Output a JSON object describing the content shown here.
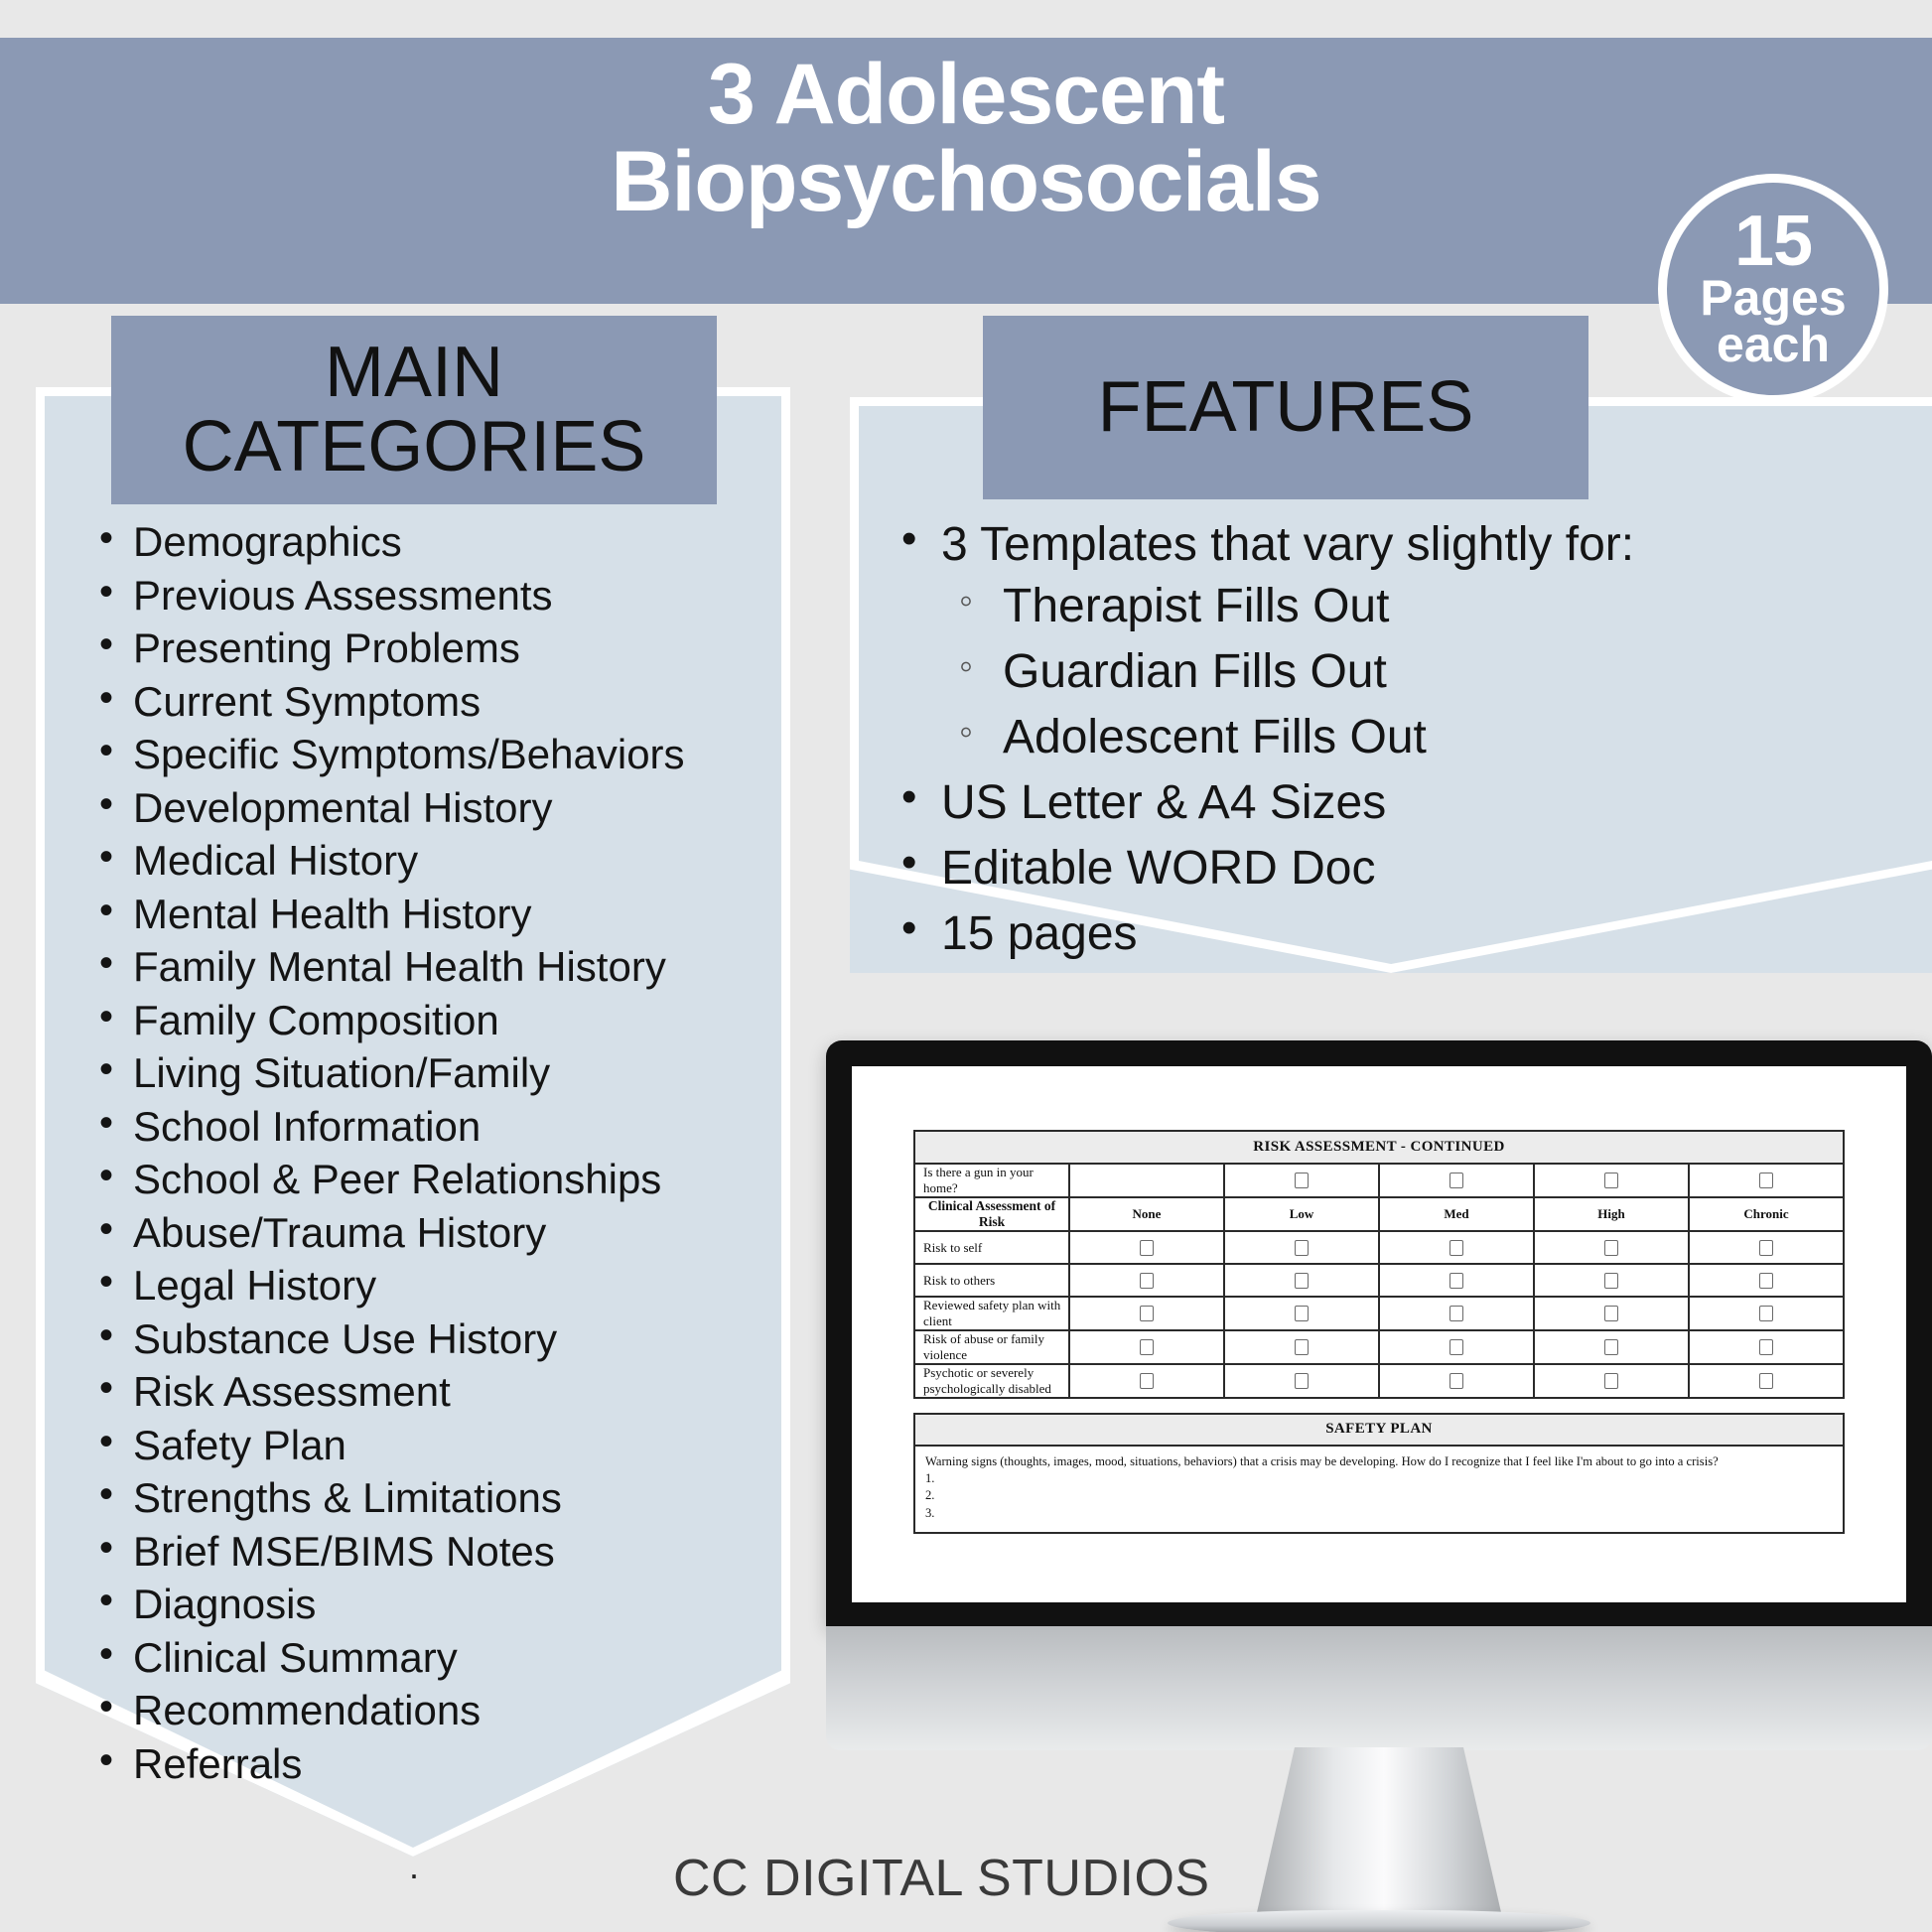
{
  "header": {
    "title": "3 Adolescent\nBiopsychosocials",
    "bar_color": "#8b99b4"
  },
  "badge": {
    "number": "15",
    "line1": "Pages",
    "line2": "each"
  },
  "main_categories": {
    "heading": "MAIN\nCATEGORIES",
    "items": [
      "Demographics",
      "Previous Assessments",
      "Presenting Problems",
      "Current Symptoms",
      "Specific Symptoms/Behaviors",
      "Developmental History",
      "Medical History",
      "Mental Health History",
      "Family Mental Health History",
      "Family Composition",
      "Living Situation/Family",
      "School Information",
      "School & Peer Relationships",
      "Abuse/Trauma History",
      "Legal History",
      "Substance Use History",
      "Risk Assessment",
      "Safety Plan",
      "Strengths & Limitations",
      "Brief MSE/BIMS Notes",
      "Diagnosis",
      "Clinical Summary",
      "Recommendations",
      "Referrals"
    ],
    "trailing_dot": "."
  },
  "features": {
    "heading": "FEATURES",
    "items": [
      {
        "text": "3 Templates that vary slightly for:",
        "sub": [
          "Therapist Fills Out",
          "Guardian Fills Out",
          "Adolescent Fills Out"
        ]
      },
      {
        "text": "US Letter & A4 Sizes",
        "sub": []
      },
      {
        "text": "Editable WORD Doc",
        "sub": []
      },
      {
        "text": "15 pages",
        "sub": []
      }
    ]
  },
  "document": {
    "risk_title": "RISK ASSESSMENT - CONTINUED",
    "gun_question": "Is there a gun in your home?",
    "clinical_label": "Clinical Assessment of Risk",
    "columns": [
      "None",
      "Low",
      "Med",
      "High",
      "Chronic"
    ],
    "rows": [
      "Risk to self",
      "Risk to others",
      "Reviewed safety plan with client",
      "Risk of abuse or family violence",
      "Psychotic or severely psychologically disabled"
    ],
    "safety_title": "SAFETY PLAN",
    "safety_prompt": "Warning signs (thoughts, images, mood, situations, behaviors) that a crisis may be developing. How do I recognize that I feel like I'm about to go into a crisis?",
    "safety_numbers": [
      "1.",
      "2.",
      "3."
    ]
  },
  "footer": {
    "brand": "CC DIGITAL STUDIOS"
  },
  "colors": {
    "page_bg": "#e8e8e8",
    "accent": "#8b99b4",
    "panel_bg": "#d6e0e8",
    "text": "#141414"
  }
}
